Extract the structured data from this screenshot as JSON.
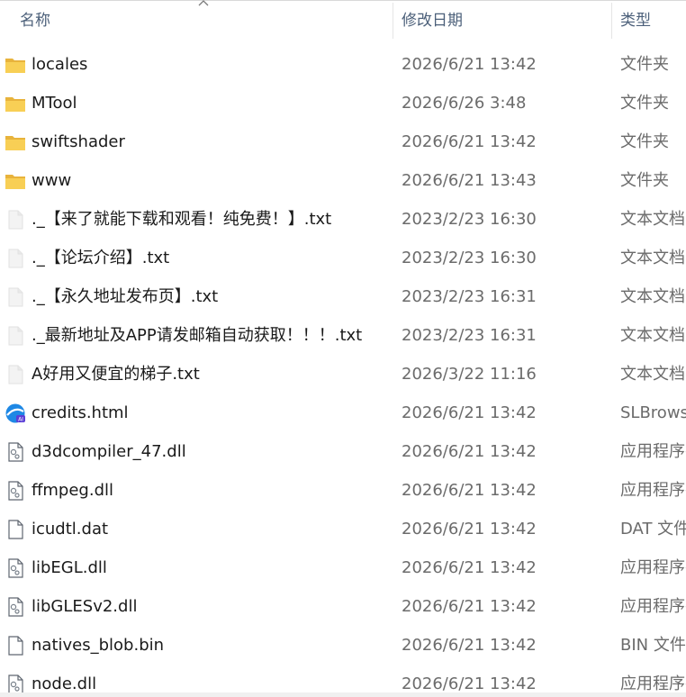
{
  "columns": {
    "name": "名称",
    "date": "修改日期",
    "type": "类型"
  },
  "files": [
    {
      "name": "locales",
      "date": "2026/6/21 13:42",
      "type": "文件夹",
      "icon": "folder-icon"
    },
    {
      "name": "MTool",
      "date": "2026/6/26 3:48",
      "type": "文件夹",
      "icon": "folder-icon"
    },
    {
      "name": "swiftshader",
      "date": "2026/6/21 13:42",
      "type": "文件夹",
      "icon": "folder-icon"
    },
    {
      "name": "www",
      "date": "2026/6/21 13:43",
      "type": "文件夹",
      "icon": "folder-icon"
    },
    {
      "name": "._【来了就能下载和观看！纯免费！】.txt",
      "date": "2023/2/23 16:30",
      "type": "文本文档",
      "icon": "text-file-icon"
    },
    {
      "name": "._【论坛介绍】.txt",
      "date": "2023/2/23 16:30",
      "type": "文本文档",
      "icon": "text-file-icon"
    },
    {
      "name": "._【永久地址发布页】.txt",
      "date": "2023/2/23 16:31",
      "type": "文本文档",
      "icon": "text-file-icon"
    },
    {
      "name": "._最新地址及APP请发邮箱自动获取！！！.txt",
      "date": "2023/2/23 16:31",
      "type": "文本文档",
      "icon": "text-file-icon"
    },
    {
      "name": "A好用又便宜的梯子.txt",
      "date": "2026/3/22 11:16",
      "type": "文本文档",
      "icon": "text-file-icon"
    },
    {
      "name": "credits.html",
      "date": "2026/6/21 13:42",
      "type": "SLBrowser",
      "icon": "browser-icon"
    },
    {
      "name": "d3dcompiler_47.dll",
      "date": "2026/6/21 13:42",
      "type": "应用程序扩展",
      "icon": "dll-file-icon"
    },
    {
      "name": "ffmpeg.dll",
      "date": "2026/6/21 13:42",
      "type": "应用程序扩展",
      "icon": "dll-file-icon"
    },
    {
      "name": "icudtl.dat",
      "date": "2026/6/21 13:42",
      "type": "DAT 文件",
      "icon": "blank-file-icon"
    },
    {
      "name": "libEGL.dll",
      "date": "2026/6/21 13:42",
      "type": "应用程序扩展",
      "icon": "dll-file-icon"
    },
    {
      "name": "libGLESv2.dll",
      "date": "2026/6/21 13:42",
      "type": "应用程序扩展",
      "icon": "dll-file-icon"
    },
    {
      "name": "natives_blob.bin",
      "date": "2026/6/21 13:42",
      "type": "BIN 文件",
      "icon": "blank-file-icon"
    },
    {
      "name": "node.dll",
      "date": "2026/6/21 13:42",
      "type": "应用程序扩展",
      "icon": "dll-file-icon"
    }
  ]
}
